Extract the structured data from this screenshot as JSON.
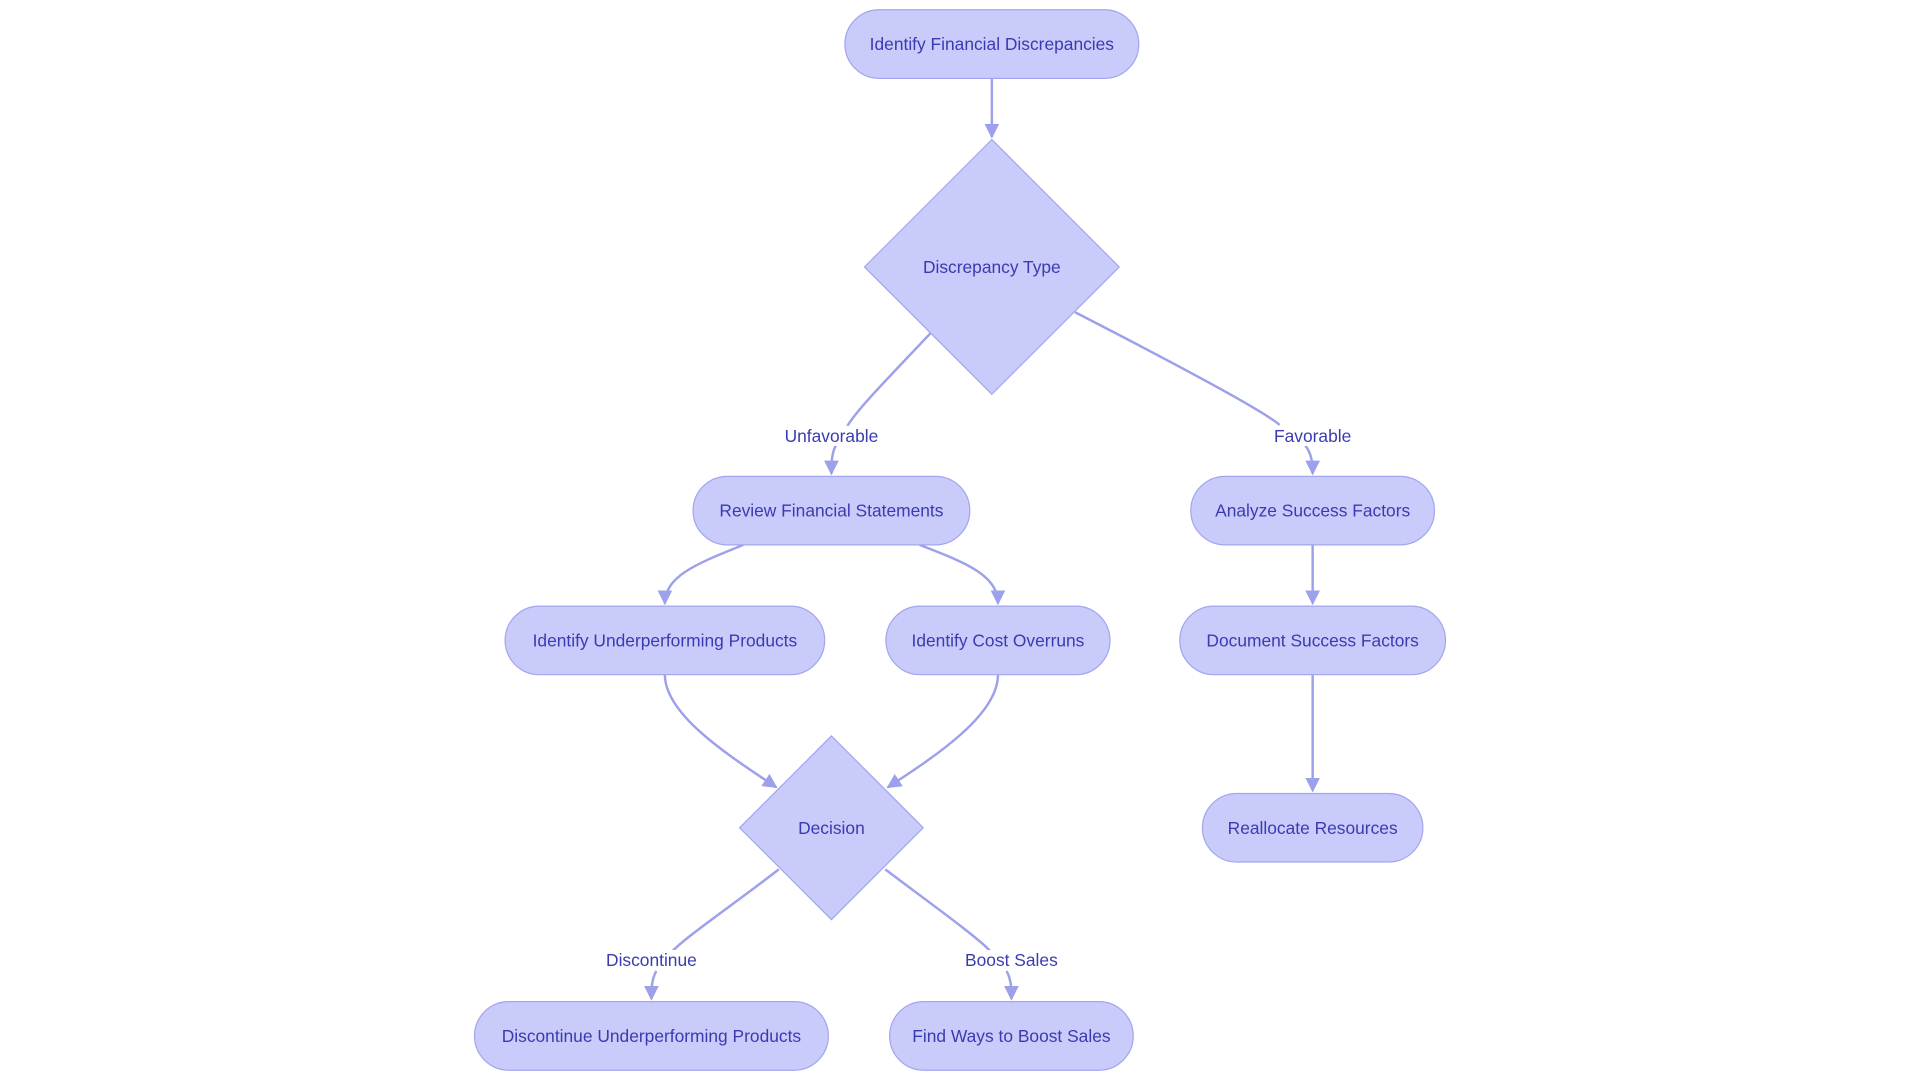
{
  "diagram": {
    "type": "flowchart",
    "colors": {
      "node_fill": "#c9cbfb",
      "node_stroke": "#a3a6ee",
      "edge": "#9da0ea",
      "text": "#3a3bb0"
    },
    "nodes": {
      "identify": {
        "label": "Identify Financial Discrepancies",
        "shape": "rounded"
      },
      "type": {
        "label": "Discrepancy Type",
        "shape": "diamond"
      },
      "review": {
        "label": "Review Financial Statements",
        "shape": "rounded"
      },
      "analyze": {
        "label": "Analyze Success Factors",
        "shape": "rounded"
      },
      "underperf": {
        "label": "Identify Underperforming Products",
        "shape": "rounded"
      },
      "cost": {
        "label": "Identify Cost Overruns",
        "shape": "rounded"
      },
      "document": {
        "label": "Document Success Factors",
        "shape": "rounded"
      },
      "decision": {
        "label": "Decision",
        "shape": "diamond"
      },
      "reallocate": {
        "label": "Reallocate Resources",
        "shape": "rounded"
      },
      "discontinue": {
        "label": "Discontinue Underperforming Products",
        "shape": "rounded"
      },
      "boost": {
        "label": "Find Ways to Boost Sales",
        "shape": "rounded"
      }
    },
    "edges": [
      {
        "from": "identify",
        "to": "type",
        "label": ""
      },
      {
        "from": "type",
        "to": "review",
        "label": "Unfavorable"
      },
      {
        "from": "type",
        "to": "analyze",
        "label": "Favorable"
      },
      {
        "from": "review",
        "to": "underperf",
        "label": ""
      },
      {
        "from": "review",
        "to": "cost",
        "label": ""
      },
      {
        "from": "analyze",
        "to": "document",
        "label": ""
      },
      {
        "from": "document",
        "to": "reallocate",
        "label": ""
      },
      {
        "from": "underperf",
        "to": "decision",
        "label": ""
      },
      {
        "from": "cost",
        "to": "decision",
        "label": ""
      },
      {
        "from": "decision",
        "to": "discontinue",
        "label": "Discontinue"
      },
      {
        "from": "decision",
        "to": "boost",
        "label": "Boost Sales"
      }
    ]
  }
}
